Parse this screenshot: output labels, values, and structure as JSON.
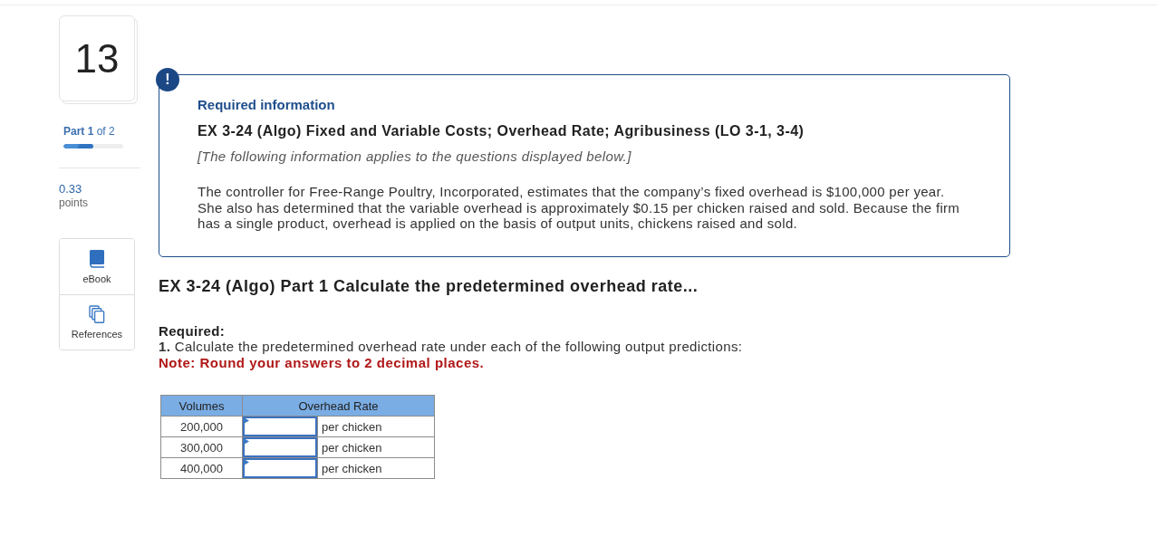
{
  "question": {
    "number": "13"
  },
  "part": {
    "label": "**Part 1** of 2",
    "level": 0.5
  },
  "points": {
    "value": "0.33",
    "label": "points"
  },
  "tools": [
    {
      "kind": "book",
      "label": "eBook"
    },
    {
      "kind": "copies",
      "label": "References"
    }
  ],
  "info": {
    "badge": "!",
    "heading": "Required information",
    "title": "EX 3-24 (Algo) Fixed and Variable Costs; Overhead Rate; Agribusiness (LO 3-1, 3-4)",
    "subtitle": "[The following information applies to the questions displayed below.]",
    "body": "The controller for Free-Range Poultry, Incorporated, estimates that the company’s fixed overhead is $100,000 per year. She also has determined that the variable overhead is approximately $0.15 per chicken raised and sold. Because the firm has a single product, overhead is applied on the basis of output units, chickens raised and sold."
  },
  "part_heading": "EX 3-24 (Algo) Part 1 Calculate the predetermined overhead rate...",
  "required": {
    "label": "Required:",
    "instruction": "**1.** Calculate the predetermined overhead rate under each of the following output predictions:",
    "note": "Note: Round your answers to 2 decimal places."
  },
  "table": {
    "columns": [
      "Volumes",
      "Overhead Rate"
    ],
    "rows": [
      {
        "volume": "200,000",
        "unit": "per chicken"
      },
      {
        "volume": "300,000",
        "unit": "per chicken"
      },
      {
        "volume": "400,000",
        "unit": "per chicken"
      }
    ]
  }
}
